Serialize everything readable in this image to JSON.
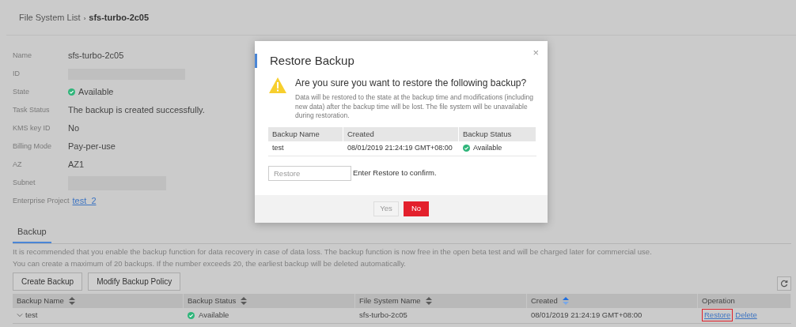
{
  "breadcrumb": {
    "parent": "File System List",
    "separator": "›",
    "current": "sfs-turbo-2c05"
  },
  "details": [
    {
      "kind": "text",
      "label": "Name",
      "value": "sfs-turbo-2c05"
    },
    {
      "kind": "masked",
      "label": "ID"
    },
    {
      "kind": "status",
      "label": "State",
      "value": "Available"
    },
    {
      "kind": "text",
      "label": "Task Status",
      "value": "The backup is created successfully."
    },
    {
      "kind": "text",
      "label": "KMS key ID",
      "value": "No"
    },
    {
      "kind": "text",
      "label": "Billing Mode",
      "value": "Pay-per-use"
    },
    {
      "kind": "text",
      "label": "AZ",
      "value": "AZ1"
    },
    {
      "kind": "masked",
      "label": "Subnet"
    },
    {
      "kind": "link",
      "label": "Enterprise Project",
      "value": "test_2"
    }
  ],
  "tabs": [
    {
      "label": "Backup",
      "selected": true
    }
  ],
  "notes": [
    "It is recommended that you enable the backup function for data recovery in case of data loss. The backup function is now free in the open beta test and will be charged later for commercial use.",
    "You can create a maximum of 20 backups. If the number exceeds 20, the earliest backup will be deleted automatically."
  ],
  "buttons": [
    "Create Backup",
    "Modify Backup Policy"
  ],
  "table": {
    "columns": [
      {
        "label": "Backup Name",
        "sort_active": false
      },
      {
        "label": "Backup Status",
        "sort_active": false
      },
      {
        "label": "File System Name",
        "sort_active": false
      },
      {
        "label": "Created",
        "sort_active": true
      },
      {
        "label": "Operation"
      }
    ],
    "rows": [
      {
        "name": "test",
        "expanded": false,
        "status": "Available",
        "file_system": "sfs-turbo-2c05",
        "created": "08/01/2019 21:24:19 GMT+08:00",
        "operations": [
          {
            "label": "Restore",
            "highlighted": true
          },
          {
            "label": "Delete",
            "highlighted": false
          }
        ]
      }
    ]
  },
  "dialog": {
    "title": "Restore Backup",
    "close": "×",
    "question": "Are you sure you want to restore the following backup?",
    "description": "Data will be restored to the state at the backup time and modifications (including new data) after the backup time will be lost. The file system will be unavailable during restoration.",
    "columns": [
      "Backup Name",
      "Created",
      "Backup Status"
    ],
    "rows": [
      {
        "name": "test",
        "created": "08/01/2019 21:24:19 GMT+08:00",
        "status": "Available"
      }
    ],
    "confirm_field": {
      "placeholder": "Restore"
    },
    "confirm_hint": "Enter Restore to confirm.",
    "buttons": [
      {
        "label": "Yes",
        "kind": "secondary",
        "disabled": true
      },
      {
        "label": "No",
        "kind": "danger",
        "disabled": false
      }
    ]
  }
}
